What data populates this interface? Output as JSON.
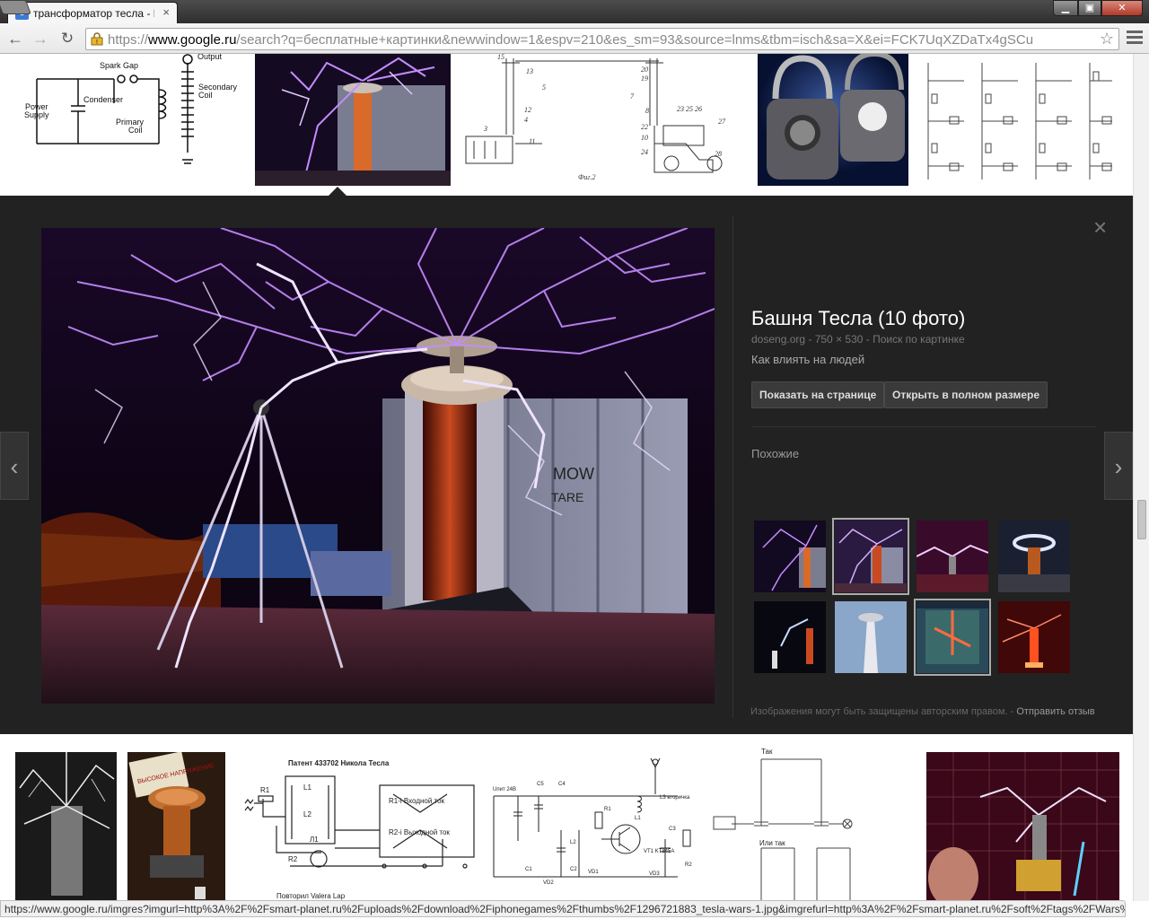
{
  "browser": {
    "tab_title": "трансформатор тесла - Г",
    "tab_favicon": "8",
    "url_scheme": "https://",
    "url_host": "www.google.ru",
    "url_path": "/search?q=бесплатные+картинки&newwindow=1&espv=210&es_sm=93&source=lnms&tbm=isch&sa=X&ei=FCK7UqXZDaTx4gSCu",
    "status_url": "https://www.google.ru/imgres?imgurl=http%3A%2F%2Fsmart-planet.ru%2Fuploads%2Fdownload%2Fiphonegames%2Fthumbs%2F1296721883_tesla-wars-1.jpg&imgrefurl=http%3A%2F%2Fsmart-planet.ru%2Fsoft%2Ftags%2FWars%2..."
  },
  "top_row": {
    "circuit_labels": {
      "spark_gap": "Spark Gap",
      "output": "Output",
      "condenser": "Condenser",
      "power": "Power",
      "supply": "Supply",
      "primary": "Primary",
      "coil": "Coil",
      "secondary": "Secondary",
      "secondary_coil": "Coil"
    },
    "patent_caption": "Фиг.2"
  },
  "preview": {
    "title": "Башня Тесла (10 фото)",
    "meta": "doseng.org - 750 × 530 - Поиск по картинке",
    "subtitle": "Как влиять на людей",
    "show_on_page": "Показать на странице",
    "open_full": "Открыть в полном размере",
    "similar_label": "Похожие",
    "copyright": "Изображения могут быть защищены авторским правом.",
    "separator": "-",
    "feedback": "Отправить отзыв",
    "close_icon": "×",
    "prev_icon": "‹",
    "next_icon": "›",
    "container_text_1": "MOW",
    "container_text_2": "TARE"
  },
  "bottom_row": {
    "patent_title": "Патент 433702   Никола Тесла",
    "patent_input": "R1-i  Входной ток",
    "patent_output": "R2-i  Выходной ток",
    "patent_footer": "Повторил Valera   Lap",
    "schem_input": "Uпит 24В",
    "schem_transistor": "VT1 KT845A",
    "schem_secondary": "L3 вторичка",
    "tak_label": "Так",
    "ili_tak_label": "Или так",
    "warning_text": "ВЫСОКОЕ НАПРЯЖЕНИЕ"
  },
  "colors": {
    "preview_bg": "#222222",
    "lightning": "#c58cff",
    "accent_blue": "#3a7bd5"
  }
}
